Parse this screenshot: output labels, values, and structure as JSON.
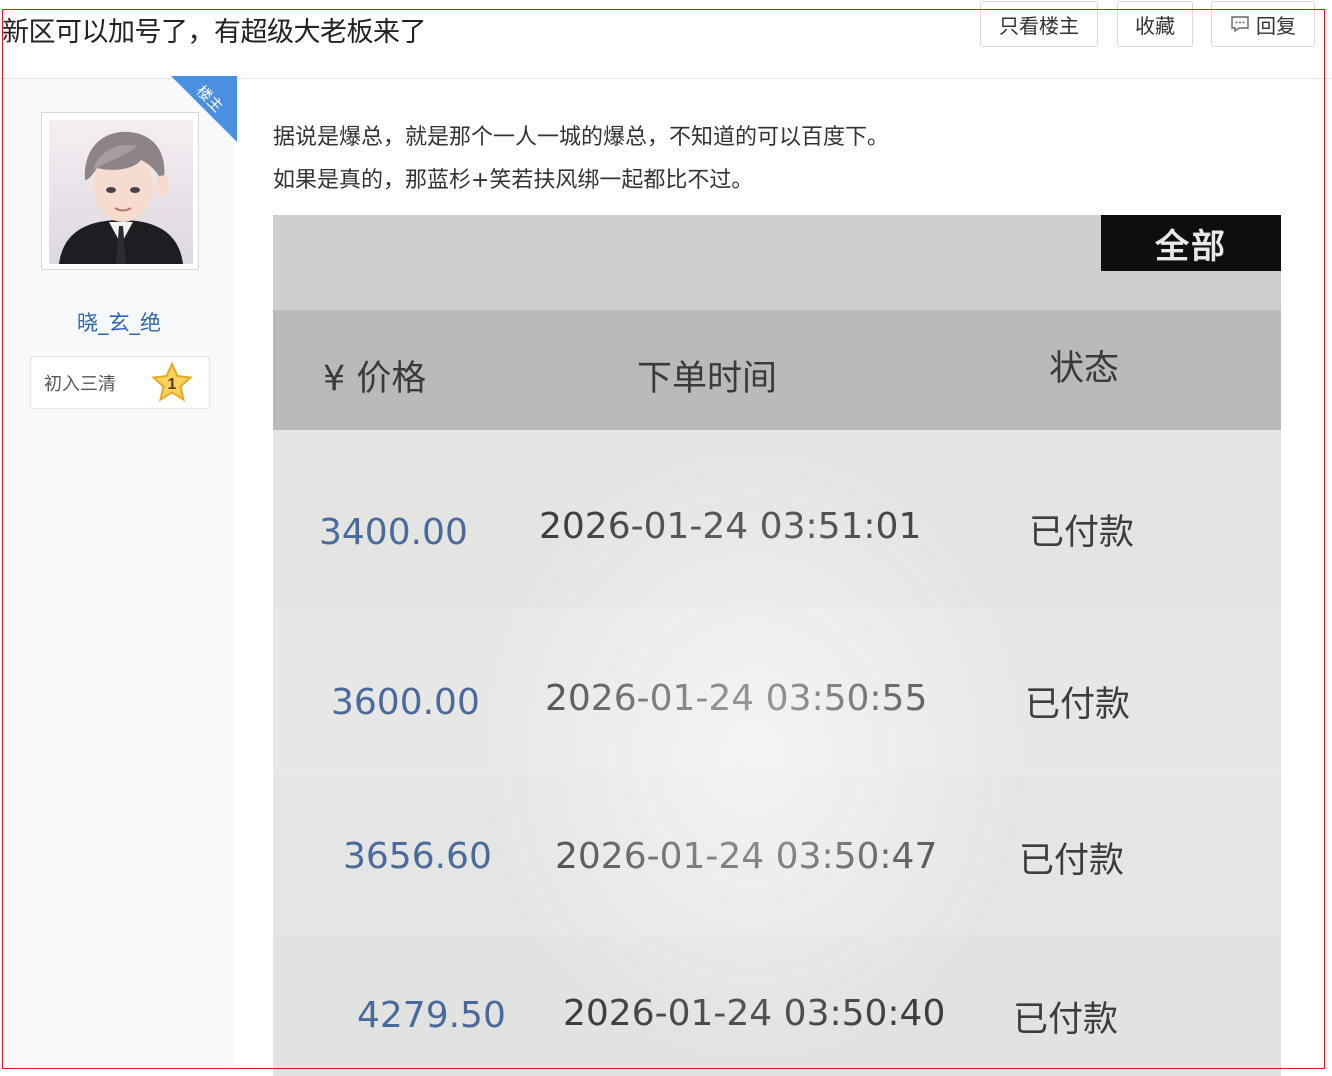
{
  "header": {
    "title": "新区可以加号了，有超级大老板来了",
    "only_author_label": "只看楼主",
    "favorite_label": "收藏",
    "reply_label": "回复"
  },
  "author": {
    "badge": "楼主",
    "name": "晓_玄_绝",
    "level_title": "初入三清",
    "level_number": "1"
  },
  "post": {
    "lines": [
      "据说是爆总，就是那个一人一城的爆总，不知道的可以百度下。",
      "如果是真的，那蓝杉+笑若扶风绑一起都比不过。"
    ]
  },
  "photo": {
    "tab_label": "全部",
    "columns": [
      "¥ 价格",
      "下单时间",
      "状态"
    ],
    "rows": [
      {
        "price": "3400.00",
        "time": "2026-01-24 03:51:01",
        "status": "已付款"
      },
      {
        "price": "3600.00",
        "time": "2026-01-24 03:50:55",
        "status": "已付款"
      },
      {
        "price": "3656.60",
        "time": "2026-01-24 03:50:47",
        "status": "已付款"
      },
      {
        "price": "4279.50",
        "time": "2026-01-24 03:50:40",
        "status": "已付款"
      }
    ]
  },
  "colors": {
    "accent_blue": "#2d64b3",
    "badge_blue": "#4a8fe0",
    "frame_red": "#e0191f"
  }
}
